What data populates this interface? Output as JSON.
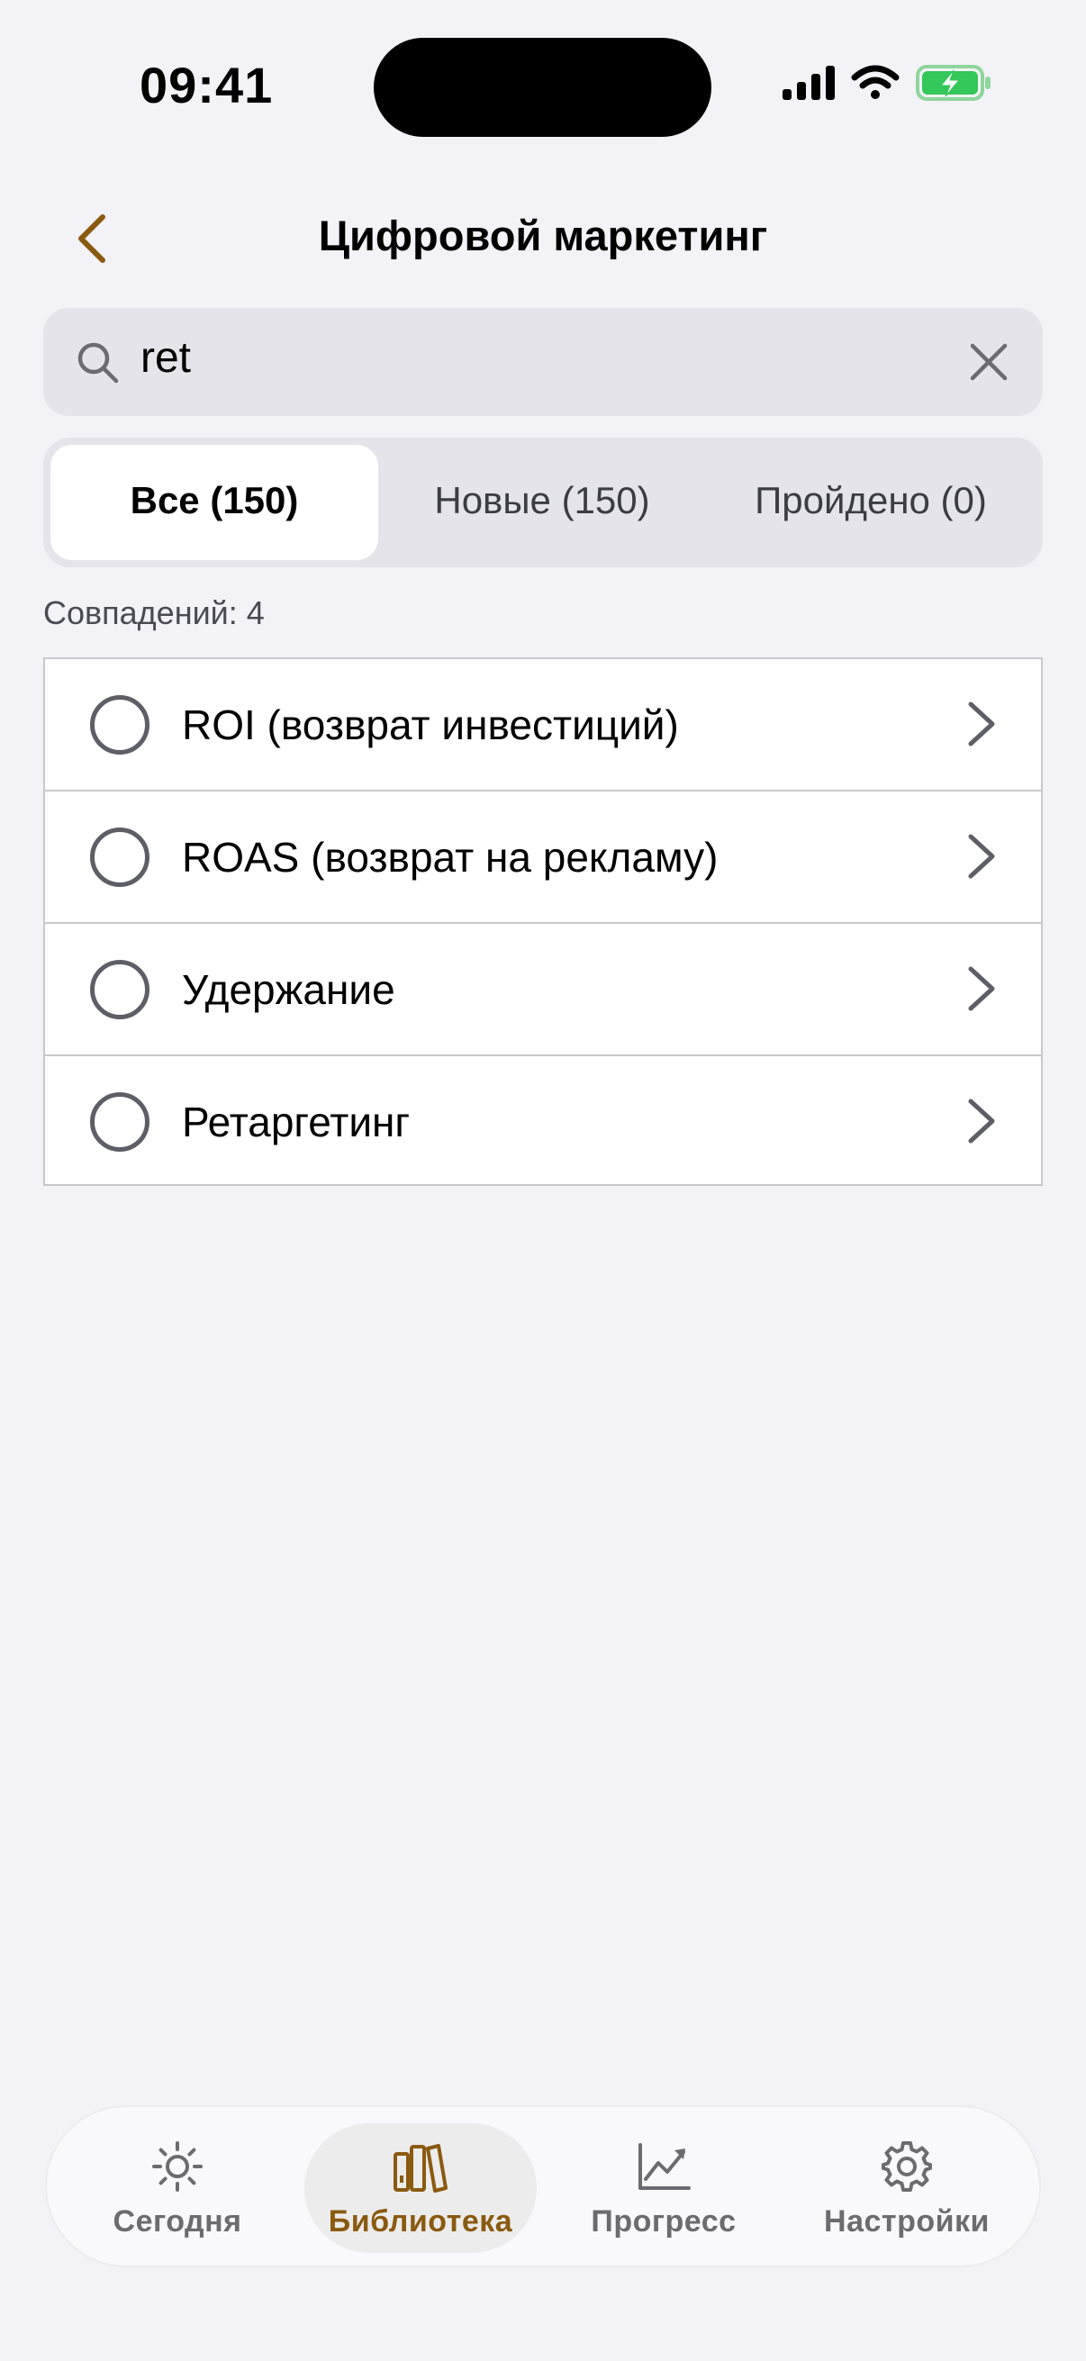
{
  "status_bar": {
    "time": "09:41"
  },
  "nav": {
    "title": "Цифровой маркетинг"
  },
  "search": {
    "value": "ret"
  },
  "segments": [
    {
      "label": "Все (150)",
      "active": true
    },
    {
      "label": "Новые (150)",
      "active": false
    },
    {
      "label": "Пройдено (0)",
      "active": false
    }
  ],
  "match_count": "Совпадений: 4",
  "items": [
    {
      "label": "ROI (возврат инвестиций)"
    },
    {
      "label": "ROAS (возврат на рекламу)"
    },
    {
      "label": "Удержание"
    },
    {
      "label": "Ретаргетинг"
    }
  ],
  "tabbar": [
    {
      "label": "Сегодня",
      "icon": "sun-icon"
    },
    {
      "label": "Библиотека",
      "icon": "books-icon",
      "active": true
    },
    {
      "label": "Прогресс",
      "icon": "chart-icon"
    },
    {
      "label": "Настройки",
      "icon": "gear-icon"
    }
  ],
  "colors": {
    "accent": "#8A5A10",
    "background": "#F2F2F7",
    "battery_green": "#34C759"
  }
}
